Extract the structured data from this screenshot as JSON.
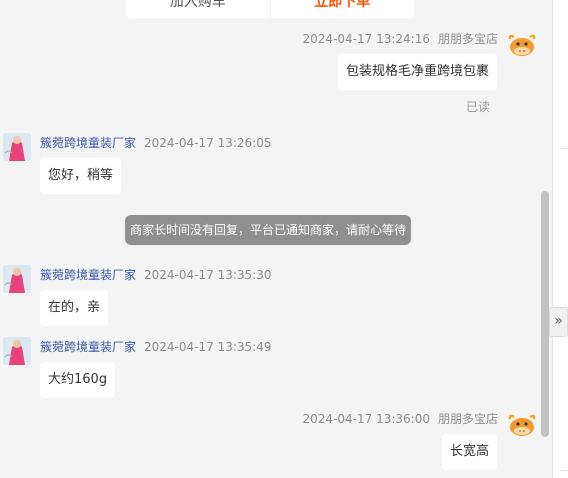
{
  "top_buttons": {
    "left": "加入购车",
    "right": "立即下单"
  },
  "messages": [
    {
      "type": "shop",
      "time": "2024-04-17 13:24:16",
      "sender": "朋朋多宝店",
      "text": "包装规格毛净重跨境包裹",
      "status": "已读"
    },
    {
      "type": "buyer",
      "sender": "簇菀跨境童装厂家",
      "time": "2024-04-17 13:26:05",
      "text": "您好，稍等"
    },
    {
      "type": "buyer",
      "sender": "簇菀跨境童装厂家",
      "time": "2024-04-17 13:35:30",
      "text": "在的，亲"
    },
    {
      "type": "buyer",
      "sender": "簇菀跨境童装厂家",
      "time": "2024-04-17 13:35:49",
      "text": "大约160g"
    },
    {
      "type": "shop",
      "time": "2024-04-17 13:36:00",
      "sender": "朋朋多宝店",
      "text": "长宽高"
    }
  ],
  "system_notice": "商家长时间没有回复，平台已通知商家，请耐心等待",
  "collapse_icon": "»",
  "icons": {
    "buyer_avatar": "buyer-avatar-icon",
    "shop_avatar": "cow-avatar-icon",
    "collapse": "double-chevron-right-icon"
  },
  "colors": {
    "sender_name": "#3a58b0",
    "notice_bg": "#8f8f8f",
    "primary": "#ff5000"
  }
}
